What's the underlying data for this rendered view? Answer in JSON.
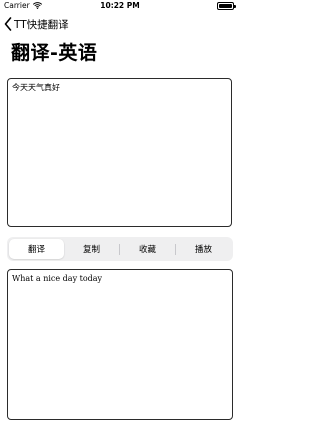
{
  "status_bar": {
    "carrier": "Carrier",
    "time": "10:22 PM",
    "wifi_icon": "wifi-icon",
    "battery_icon": "battery-icon"
  },
  "nav": {
    "back_icon": "chevron-left-icon",
    "back_label": "TT快捷翻译"
  },
  "page": {
    "title": "翻译-英语"
  },
  "source": {
    "text": "今天天气真好"
  },
  "actions": {
    "segments": [
      {
        "label": "翻译",
        "selected": true
      },
      {
        "label": "复制",
        "selected": false
      },
      {
        "label": "收藏",
        "selected": false
      },
      {
        "label": "播放",
        "selected": false
      }
    ]
  },
  "result": {
    "text": "What a nice day today"
  }
}
